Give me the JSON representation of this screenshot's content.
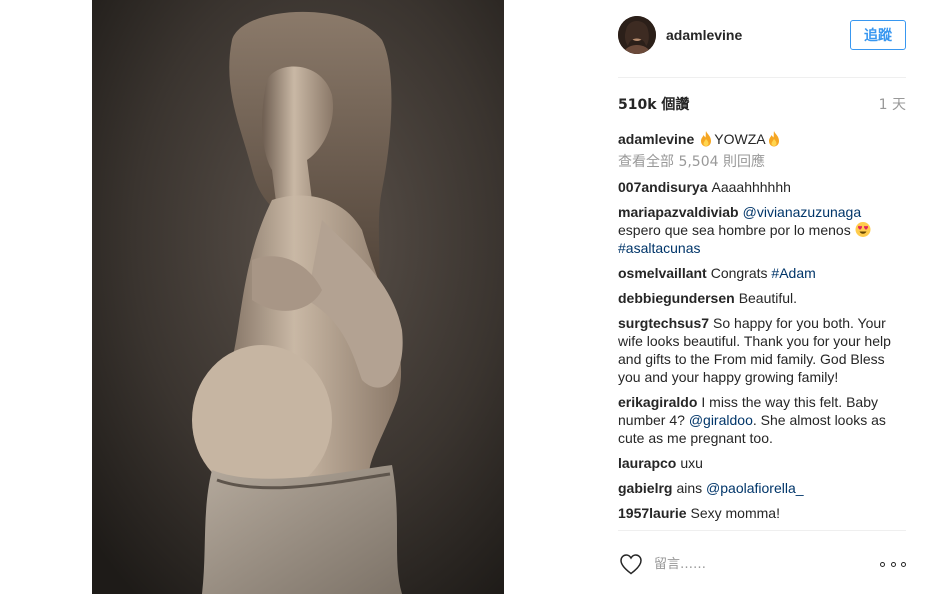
{
  "post": {
    "author": "adamlevine",
    "follow_label": "追蹤",
    "views": "510k 個讚",
    "time": "1 天"
  },
  "caption": {
    "user": "adamlevine",
    "text": "YOWZA"
  },
  "view_all": "查看全部 5,504 則回應",
  "comments": [
    {
      "user": "007andisurya",
      "text": "Aaaahhhhhh"
    },
    {
      "user": "mariapazvaldiviab",
      "mention": "@vivianazuzunaga",
      "text": "espero que sea hombre por lo menos",
      "hashtag": "#asaltacunas"
    },
    {
      "user": "osmelvaillant",
      "text": "Congrats",
      "hashtag": "#Adam"
    },
    {
      "user": "debbiegundersen",
      "text": "Beautiful."
    },
    {
      "user": "surgtechsus7",
      "text": "So happy for you both. Your wife looks beautiful. Thank you for your help and gifts to the From mid family. God Bless you and your happy growing family!"
    },
    {
      "user": "erikagiraldo",
      "text": "I miss the way this felt. Baby number 4?",
      "mention": "@giraldoo",
      "text2": ". She almost looks as cute as me pregnant too."
    },
    {
      "user": "laurapco",
      "text": "uxu"
    },
    {
      "user": "gabielrg",
      "text": "ains",
      "mention": "@paolafiorella_"
    },
    {
      "user": "1957laurie",
      "text": "Sexy momma!"
    }
  ],
  "input": {
    "placeholder": "留言……"
  },
  "icons": {
    "like": "heart-icon",
    "more": "more-options-icon",
    "fire": "fire-emoji-icon",
    "heart_eyes": "heart-eyes-emoji-icon"
  },
  "colors": {
    "accent": "#3897f0",
    "link": "#003569",
    "muted": "#999999"
  }
}
